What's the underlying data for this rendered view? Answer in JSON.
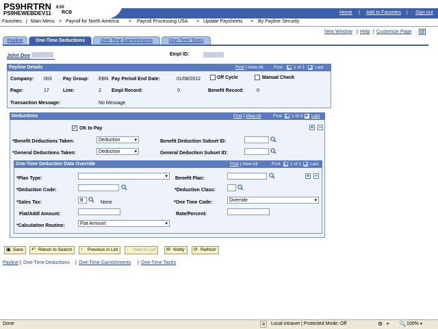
{
  "header": {
    "app_name": "PS9HRTRN",
    "version": "8.50",
    "db_name": "PS9HEWEBDEV11",
    "db_code": "RCB",
    "links": [
      "Home",
      "Add to Favorites",
      "Sign out"
    ]
  },
  "breadcrumb": [
    "Favorites",
    "Main Menu",
    "Payroll for North America",
    "Payroll Processing USA",
    "Update Paysheets",
    "By Payline Security"
  ],
  "toplinks": {
    "new_window": "New Window",
    "help": "Help",
    "customize": "Customize Page"
  },
  "tabs": [
    {
      "label": "Payline",
      "active": false
    },
    {
      "label": "One-Time Deductions",
      "active": true
    },
    {
      "label": "One-Time Garnishments",
      "active": false
    },
    {
      "label": "One-Time Taxes",
      "active": false
    }
  ],
  "employee": {
    "name": "John Doe",
    "empl_id_label": "Empl ID:"
  },
  "payline": {
    "title": "Payline Details",
    "nav": {
      "find": "Find",
      "view_all": "View All",
      "first": "First",
      "count": "1 of 1",
      "last": "Last"
    },
    "company_label": "Company:",
    "company": "003",
    "pay_group_label": "Pay Group:",
    "pay_group": "EBN",
    "period_end_label": "Pay Period End Date:",
    "period_end": "01/08/2012",
    "off_cycle_label": "Off Cycle",
    "manual_check_label": "Manual Check",
    "page_label": "Page:",
    "page": "17",
    "line_label": "Line:",
    "line": "2",
    "empl_record_label": "Empl Record:",
    "empl_record": "0",
    "benefit_record_label": "Benefit Record:",
    "benefit_record": "0",
    "transaction_label": "Transaction Message:",
    "transaction": "No Message"
  },
  "deductions": {
    "title": "Deductions",
    "nav": {
      "find": "Find",
      "view_all": "View All",
      "first": "First",
      "count": "1 of 4",
      "last": "Last"
    },
    "ok_to_pay_label": "OK to Pay",
    "benefit_taken_label": "*Benefit Deductions Taken:",
    "benefit_taken": "Deduction",
    "general_taken_label": "*General Deductions Taken:",
    "general_taken": "Deduction",
    "benefit_subset_label": "Benefit Deduction Subset ID:",
    "general_subset_label": "General Deduction Subset ID:"
  },
  "override": {
    "title": "One-Time Deduction Data Override",
    "nav": {
      "find": "Find",
      "view_all": "View All",
      "first": "First",
      "count": "1 of 1",
      "last": "Last"
    },
    "plan_type_label": "*Plan Type:",
    "benefit_plan_label": "Benefit Plan:",
    "deduction_code_label": "*Deduction Code:",
    "deduction_class_label": "*Deduction Class:",
    "sales_tax_label": "*Sales Tax:",
    "sales_tax": "B",
    "sales_tax_desc": "None",
    "one_time_code_label": "*One Time Code:",
    "one_time_code": "Override",
    "flat_amount_label": "Flat/Addl Amount:",
    "rate_label": "Rate/Percent:",
    "calc_routine_label": "*Calculation Routine:",
    "calc_routine": "Flat Amount"
  },
  "buttons": {
    "save": "Save",
    "return": "Return to Search",
    "prev": "Previous in List",
    "next": "Next in List",
    "notify": "Notify",
    "refresh": "Refresh"
  },
  "bottom_links": [
    "Payline",
    "One-Time Deductions",
    "One-Time Garnishments",
    "One-Time Taxes"
  ],
  "status": {
    "left": "Done",
    "zone": "Local intranet | Protected Mode: Off",
    "zoom": "100%"
  }
}
